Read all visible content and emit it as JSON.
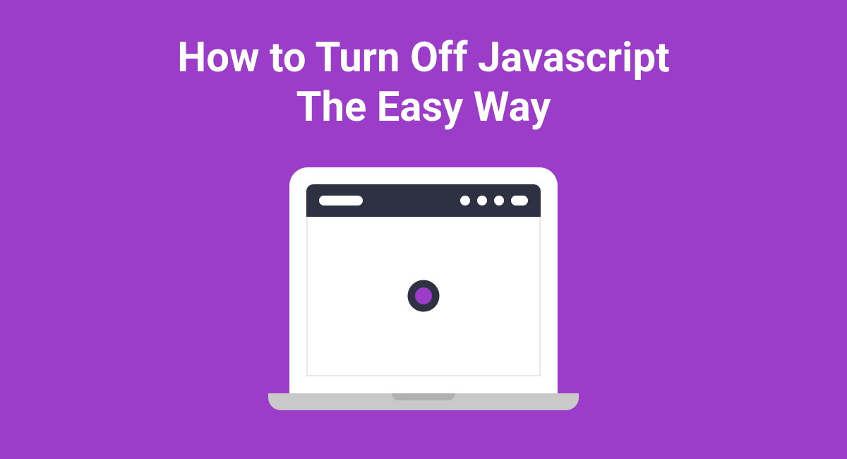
{
  "title": {
    "line1": "How to Turn Off Javascript",
    "line2": "The Easy Way"
  },
  "colors": {
    "background": "#9b3dc9",
    "text": "#ffffff",
    "browserBar": "#2d3142",
    "laptopBase": "#c9c9c9",
    "gearCenter": "#2d3142"
  },
  "icons": {
    "gear": "gear-icon",
    "laptop": "laptop-icon"
  }
}
